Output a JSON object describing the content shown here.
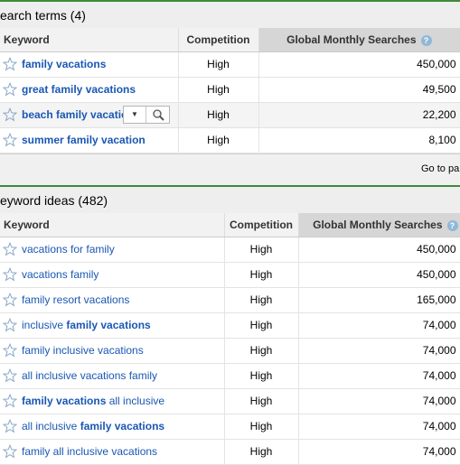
{
  "search_terms": {
    "title": "earch terms (4)",
    "headers": {
      "keyword": "Keyword",
      "competition": "Competition",
      "searches": "Global Monthly Searches"
    },
    "rows": [
      {
        "keyword": "family vacations",
        "competition": "High",
        "searches": "450,000"
      },
      {
        "keyword": "great family vacations",
        "competition": "High",
        "searches": "49,500"
      },
      {
        "keyword": "beach family vacatio",
        "competition": "High",
        "searches": "22,200"
      },
      {
        "keyword": "summer family vacation",
        "competition": "High",
        "searches": "8,100"
      }
    ],
    "footer_text": "Go to pa"
  },
  "keyword_ideas": {
    "title": "eyword ideas (482)",
    "headers": {
      "keyword": "Keyword",
      "competition": "Competition",
      "searches": "Global Monthly Searches"
    },
    "rows": [
      {
        "pre": "vacations for family",
        "bold": "",
        "post": "",
        "competition": "High",
        "searches": "450,000"
      },
      {
        "pre": "vacations family",
        "bold": "",
        "post": "",
        "competition": "High",
        "searches": "450,000"
      },
      {
        "pre": "family resort vacations",
        "bold": "",
        "post": "",
        "competition": "High",
        "searches": "165,000"
      },
      {
        "pre": "inclusive ",
        "bold": "family vacations",
        "post": "",
        "competition": "High",
        "searches": "74,000"
      },
      {
        "pre": "family inclusive vacations",
        "bold": "",
        "post": "",
        "competition": "High",
        "searches": "74,000"
      },
      {
        "pre": "all inclusive vacations family",
        "bold": "",
        "post": "",
        "competition": "High",
        "searches": "74,000"
      },
      {
        "pre": "",
        "bold": "family vacations",
        "post": " all inclusive",
        "competition": "High",
        "searches": "74,000"
      },
      {
        "pre": "all inclusive ",
        "bold": "family vacations",
        "post": "",
        "competition": "High",
        "searches": "74,000"
      },
      {
        "pre": "family all inclusive vacations",
        "bold": "",
        "post": "",
        "competition": "High",
        "searches": "74,000"
      }
    ]
  },
  "icons": {
    "star": "star-outline-icon",
    "help": "help-icon",
    "dropdown": "chevron-down-icon",
    "magnifier": "magnifier-icon"
  },
  "colors": {
    "link": "#1a57b3",
    "section_border": "#3c8a3c",
    "sorted_header": "#d6d6d6"
  },
  "help_glyph": "?"
}
